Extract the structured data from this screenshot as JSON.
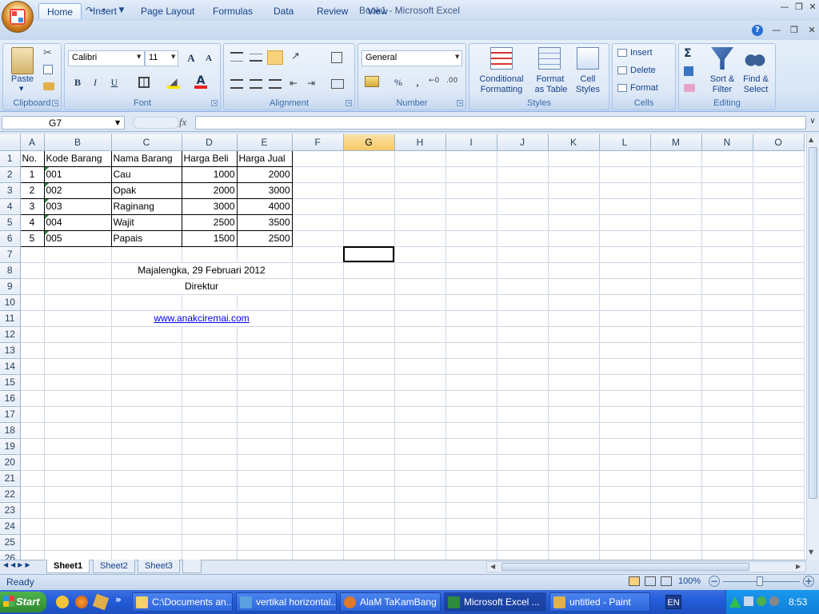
{
  "window": {
    "title": "Book1 - Microsoft Excel"
  },
  "ribbon": {
    "tabs": [
      "Home",
      "Insert",
      "Page Layout",
      "Formulas",
      "Data",
      "Review",
      "View"
    ],
    "clipboard": {
      "label": "Clipboard",
      "paste": "Paste"
    },
    "font": {
      "label": "Font",
      "family": "Calibri",
      "size": "11",
      "bold": "B",
      "italic": "I",
      "underline": "U"
    },
    "alignment": {
      "label": "Alignment"
    },
    "number": {
      "label": "Number",
      "format": "General",
      "percent": "%",
      "comma": ","
    },
    "styles": {
      "label": "Styles",
      "conditional": "Conditional",
      "conditional2": "Formatting",
      "format_as": "Format",
      "format_as2": "as Table",
      "cell": "Cell",
      "cell2": "Styles"
    },
    "cells": {
      "label": "Cells",
      "insert": "Insert",
      "delete": "Delete",
      "format": "Format"
    },
    "editing": {
      "label": "Editing",
      "sort": "Sort &",
      "sort2": "Filter",
      "find": "Find &",
      "find2": "Select"
    }
  },
  "formula_bar": {
    "name_box": "G7",
    "fx": "fx",
    "formula": ""
  },
  "sheet": {
    "columns": [
      "A",
      "B",
      "C",
      "D",
      "E",
      "F",
      "G",
      "H",
      "I",
      "J",
      "K",
      "L",
      "M",
      "N",
      "O"
    ],
    "selected_column": "G",
    "header_row": [
      "No.",
      "Kode Barang",
      "Nama Barang",
      "Harga Beli",
      "Harga Jual"
    ],
    "rows": [
      [
        "1",
        "001",
        "Cau",
        "1000",
        "2000"
      ],
      [
        "2",
        "002",
        "Opak",
        "2000",
        "3000"
      ],
      [
        "3",
        "003",
        "Raginang",
        "3000",
        "4000"
      ],
      [
        "4",
        "004",
        "Wajit",
        "2500",
        "3500"
      ],
      [
        "5",
        "005",
        "Papais",
        "1500",
        "2500"
      ]
    ],
    "footer_place_date": "Majalengka, 29 Februari 2012",
    "footer_title": "Direktur",
    "footer_link": "www.anakciremai.com",
    "row_numbers": [
      "1",
      "2",
      "3",
      "4",
      "5",
      "6",
      "7",
      "8",
      "9",
      "10",
      "11",
      "12",
      "13",
      "14",
      "15",
      "16",
      "17",
      "18",
      "19",
      "20",
      "21",
      "22",
      "23",
      "24",
      "25",
      "26"
    ]
  },
  "sheet_tabs": [
    "Sheet1",
    "Sheet2",
    "Sheet3"
  ],
  "status": {
    "ready": "Ready",
    "zoom": "100%"
  },
  "taskbar": {
    "start": "Start",
    "tasks": [
      "C:\\Documents an...",
      "vertikal horizontal...",
      "AlaM TaKamBang ...",
      "Microsoft Excel ...",
      "untitled - Paint"
    ],
    "lang": "EN",
    "clock": "8:53"
  }
}
